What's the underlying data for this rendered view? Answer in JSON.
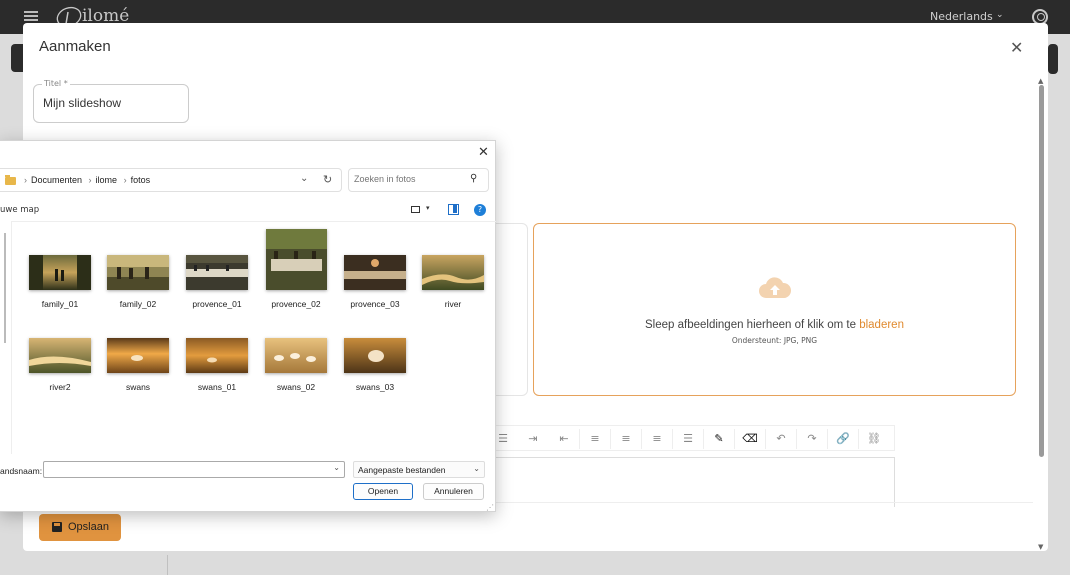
{
  "app": {
    "logo_text": "ilomé",
    "language": "Nederlands"
  },
  "modal": {
    "title": "Aanmaken",
    "title_field": {
      "label": "Titel *",
      "value": "Mijn slideshow"
    },
    "dropzone": {
      "text": "Sleep afbeeldingen hierheen of klik om te",
      "link": "bladeren",
      "formats": "Ondersteunt: JPG, PNG"
    },
    "save_label": "Opslaan",
    "accent_color": "#e0933f"
  },
  "file_dialog": {
    "path": [
      "Documenten",
      "ilome",
      "fotos"
    ],
    "search_placeholder": "Zoeken in fotos",
    "new_folder_label": "uwe map",
    "files": [
      {
        "name": "family_01"
      },
      {
        "name": "family_02"
      },
      {
        "name": "provence_01"
      },
      {
        "name": "provence_02"
      },
      {
        "name": "provence_03"
      },
      {
        "name": "river"
      },
      {
        "name": "river2"
      },
      {
        "name": "swans"
      },
      {
        "name": "swans_01"
      },
      {
        "name": "swans_02"
      },
      {
        "name": "swans_03"
      }
    ],
    "filename_label": "andsnaam:",
    "filename_value": "",
    "filter_label": "Aangepaste bestanden",
    "open_label": "Openen",
    "cancel_label": "Annuleren"
  }
}
